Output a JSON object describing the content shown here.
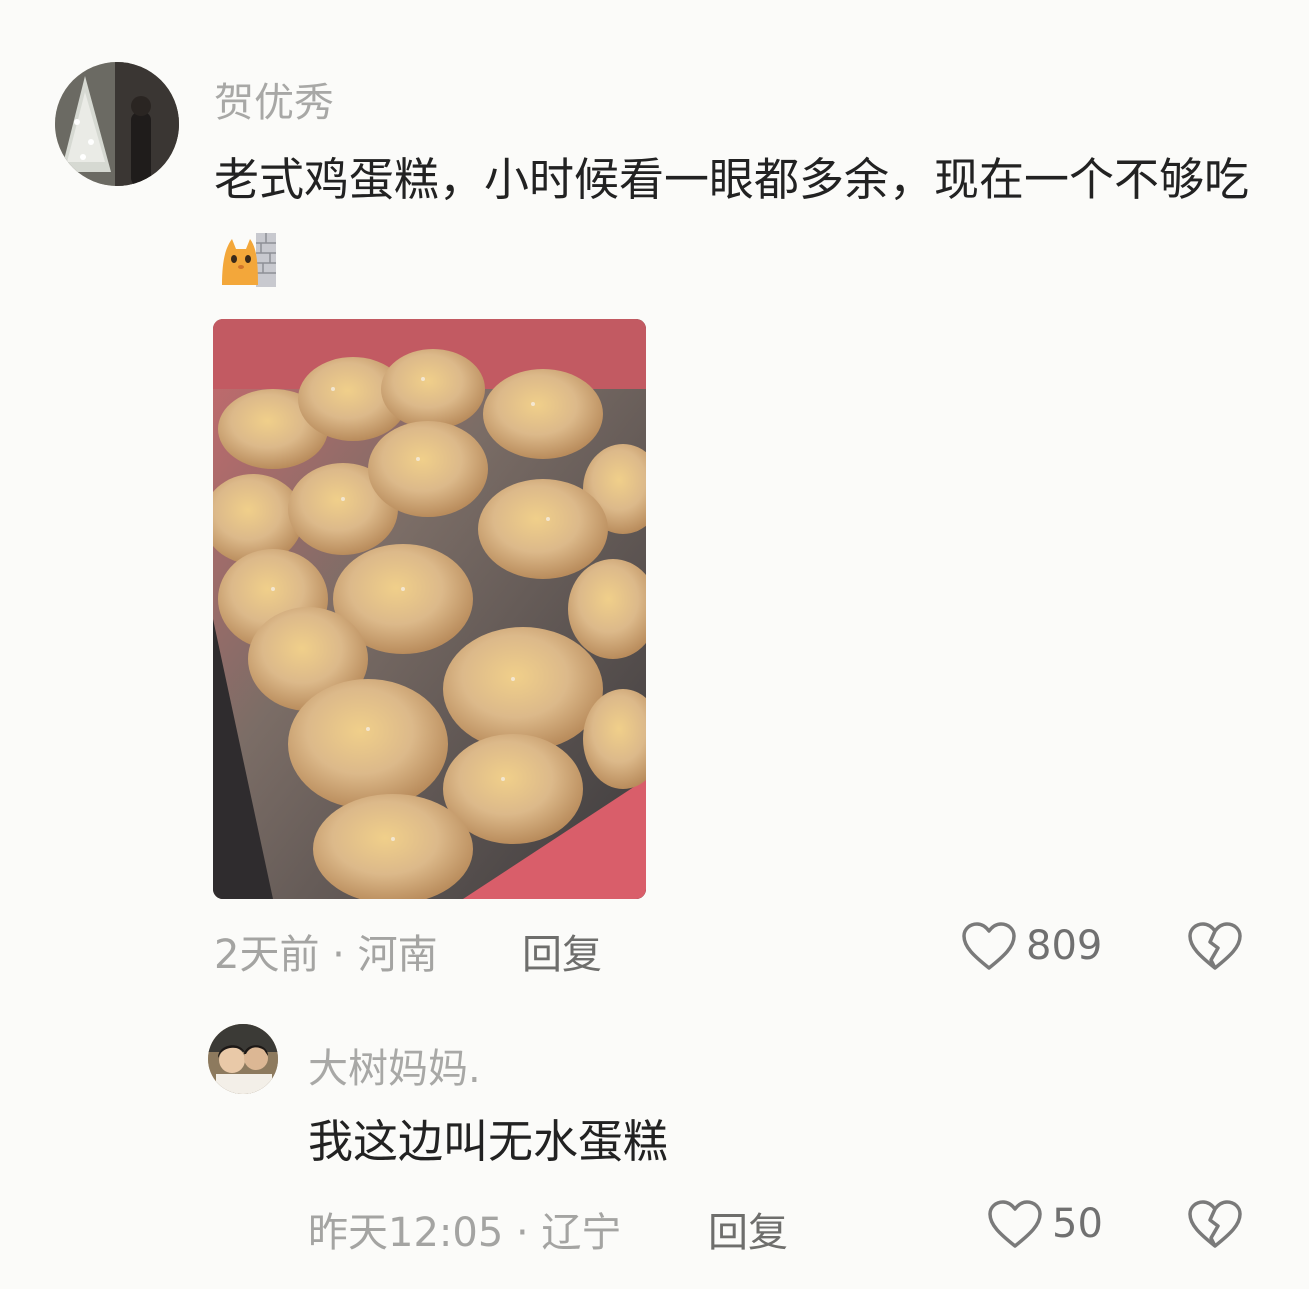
{
  "comments": [
    {
      "username": "贺优秀",
      "text": "老式鸡蛋糕，小时候看一眼都多余，现在一个不够吃",
      "emoji": "cat-peeking-emoji",
      "image": "egg-cake-photo",
      "meta": "2天前 · 河南",
      "reply_label": "回复",
      "likes": "809"
    },
    {
      "username": "大树妈妈.",
      "text": "我这边叫无水蛋糕",
      "meta": "昨天12:05 · 辽宁",
      "reply_label": "回复",
      "likes": "50"
    }
  ],
  "icons": {
    "like": "heart-outline-icon",
    "dislike": "broken-heart-icon"
  },
  "colors": {
    "background": "#fbfbf9",
    "text": "#222222",
    "muted": "#a4a4a2"
  }
}
